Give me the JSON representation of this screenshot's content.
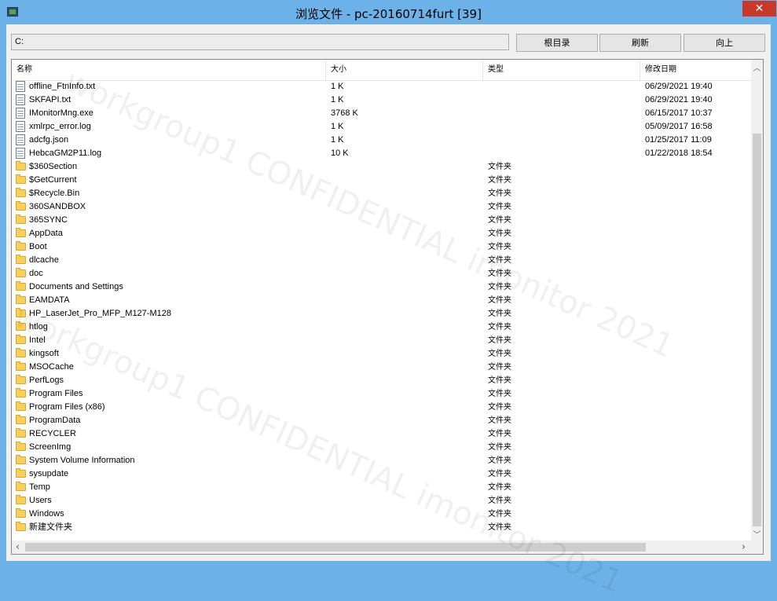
{
  "window": {
    "title": "浏览文件 - pc-20160714furt [39]",
    "close_label": "✕"
  },
  "toolbar": {
    "path_value": "C:",
    "root_label": "根目录",
    "refresh_label": "刷新",
    "up_label": "向上"
  },
  "columns": {
    "name": "名称",
    "size": "大小",
    "type": "类型",
    "date": "修改日期"
  },
  "files": [
    {
      "name": "offline_FtnInfo.txt",
      "size": "1 K",
      "type": "",
      "date": "06/29/2021 19:40",
      "icon": "file-icon"
    },
    {
      "name": "SKFAPI.txt",
      "size": "1 K",
      "type": "",
      "date": "06/29/2021 19:40",
      "icon": "file-icon"
    },
    {
      "name": "IMonitorMng.exe",
      "size": "3768 K",
      "type": "",
      "date": "06/15/2017 10:37",
      "icon": "file-icon"
    },
    {
      "name": "xmlrpc_error.log",
      "size": "1 K",
      "type": "",
      "date": "05/09/2017 16:58",
      "icon": "file-icon"
    },
    {
      "name": "adcfg.json",
      "size": "1 K",
      "type": "",
      "date": "01/25/2017 11:09",
      "icon": "file-icon"
    },
    {
      "name": "HebcaGM2P11.log",
      "size": "10 K",
      "type": "",
      "date": "01/22/2018 18:54",
      "icon": "file-icon"
    },
    {
      "name": "$360Section",
      "size": "",
      "type": "文件夹",
      "date": "",
      "icon": "folder-icon"
    },
    {
      "name": "$GetCurrent",
      "size": "",
      "type": "文件夹",
      "date": "",
      "icon": "folder-icon"
    },
    {
      "name": "$Recycle.Bin",
      "size": "",
      "type": "文件夹",
      "date": "",
      "icon": "folder-icon"
    },
    {
      "name": "360SANDBOX",
      "size": "",
      "type": "文件夹",
      "date": "",
      "icon": "folder-icon"
    },
    {
      "name": "365SYNC",
      "size": "",
      "type": "文件夹",
      "date": "",
      "icon": "folder-icon"
    },
    {
      "name": "AppData",
      "size": "",
      "type": "文件夹",
      "date": "",
      "icon": "folder-icon"
    },
    {
      "name": "Boot",
      "size": "",
      "type": "文件夹",
      "date": "",
      "icon": "folder-icon"
    },
    {
      "name": "dlcache",
      "size": "",
      "type": "文件夹",
      "date": "",
      "icon": "folder-icon"
    },
    {
      "name": "doc",
      "size": "",
      "type": "文件夹",
      "date": "",
      "icon": "folder-icon"
    },
    {
      "name": "Documents and Settings",
      "size": "",
      "type": "文件夹",
      "date": "",
      "icon": "folder-icon"
    },
    {
      "name": "EAMDATA",
      "size": "",
      "type": "文件夹",
      "date": "",
      "icon": "folder-icon"
    },
    {
      "name": "HP_LaserJet_Pro_MFP_M127-M128",
      "size": "",
      "type": "文件夹",
      "date": "",
      "icon": "folder-icon"
    },
    {
      "name": "htlog",
      "size": "",
      "type": "文件夹",
      "date": "",
      "icon": "folder-icon"
    },
    {
      "name": "Intel",
      "size": "",
      "type": "文件夹",
      "date": "",
      "icon": "folder-icon"
    },
    {
      "name": "kingsoft",
      "size": "",
      "type": "文件夹",
      "date": "",
      "icon": "folder-icon"
    },
    {
      "name": "MSOCache",
      "size": "",
      "type": "文件夹",
      "date": "",
      "icon": "folder-icon"
    },
    {
      "name": "PerfLogs",
      "size": "",
      "type": "文件夹",
      "date": "",
      "icon": "folder-icon"
    },
    {
      "name": "Program Files",
      "size": "",
      "type": "文件夹",
      "date": "",
      "icon": "folder-icon"
    },
    {
      "name": "Program Files (x86)",
      "size": "",
      "type": "文件夹",
      "date": "",
      "icon": "folder-icon"
    },
    {
      "name": "ProgramData",
      "size": "",
      "type": "文件夹",
      "date": "",
      "icon": "folder-icon"
    },
    {
      "name": "RECYCLER",
      "size": "",
      "type": "文件夹",
      "date": "",
      "icon": "folder-icon"
    },
    {
      "name": "ScreenImg",
      "size": "",
      "type": "文件夹",
      "date": "",
      "icon": "folder-icon"
    },
    {
      "name": "System Volume Information",
      "size": "",
      "type": "文件夹",
      "date": "",
      "icon": "folder-icon"
    },
    {
      "name": "sysupdate",
      "size": "",
      "type": "文件夹",
      "date": "",
      "icon": "folder-icon"
    },
    {
      "name": "Temp",
      "size": "",
      "type": "文件夹",
      "date": "",
      "icon": "folder-icon"
    },
    {
      "name": "Users",
      "size": "",
      "type": "文件夹",
      "date": "",
      "icon": "folder-icon"
    },
    {
      "name": "Windows",
      "size": "",
      "type": "文件夹",
      "date": "",
      "icon": "folder-icon"
    },
    {
      "name": "新建文件夹",
      "size": "",
      "type": "文件夹",
      "date": "",
      "icon": "folder-icon"
    }
  ],
  "watermark": "workgroup1 CONFIDENTIAL imonitor 2021",
  "scroll": {
    "up_icon": "︿",
    "down_icon": "﹀",
    "left_icon": "‹",
    "right_icon": "›"
  },
  "colors": {
    "frame": "#6cb2e8",
    "close": "#c7392b"
  }
}
